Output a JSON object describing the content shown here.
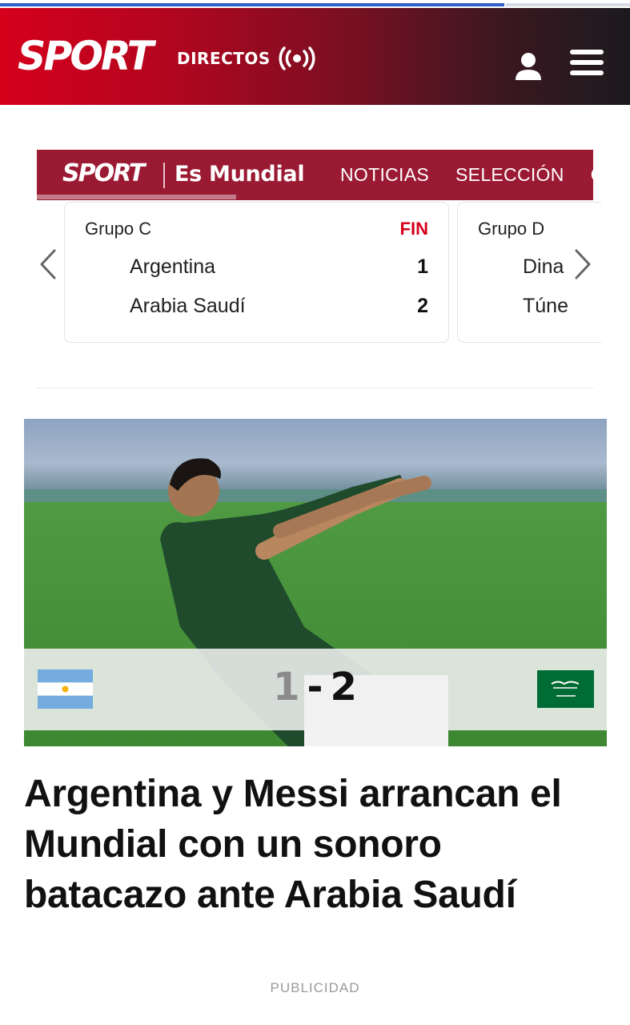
{
  "progress": {
    "fraction": 0.8
  },
  "header": {
    "logo": "SPORT",
    "directos_label": "DIRECTOS",
    "icons": {
      "live": "broadcast-icon",
      "user": "user-icon",
      "menu": "hamburger-menu-icon"
    },
    "colors": {
      "brand_red": "#d5001c",
      "dark": "#1b1a1f"
    }
  },
  "mundial": {
    "logo": "SPORT",
    "title": "Es Mundial",
    "nav": [
      "NOTICIAS",
      "SELECCIÓN",
      "CA"
    ],
    "bar_color": "#9b1a33"
  },
  "scoreboard": {
    "matches": [
      {
        "group": "Grupo C",
        "status": "FIN",
        "home": "Argentina",
        "home_score": "1",
        "away": "Arabia Saudí",
        "away_score": "2"
      },
      {
        "group": "Grupo D",
        "home": "Dina",
        "away": "Túne"
      }
    ]
  },
  "hero": {
    "score_home": "1",
    "score_sep": "-",
    "score_away": "2",
    "home_flag": "argentina-flag-icon",
    "away_flag": "saudi-arabia-flag-icon"
  },
  "article": {
    "headline": "Argentina y Messi arrancan el Mundial con un sonoro batacazo ante Arabia Saudí"
  },
  "ad": {
    "label": "PUBLICIDAD"
  }
}
